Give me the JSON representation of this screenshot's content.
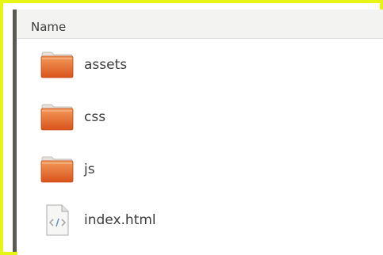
{
  "column_header": "Name",
  "items": [
    {
      "name": "assets",
      "type": "folder",
      "icon": "folder-icon"
    },
    {
      "name": "css",
      "type": "folder",
      "icon": "folder-icon"
    },
    {
      "name": "js",
      "type": "folder",
      "icon": "folder-icon"
    },
    {
      "name": "index.html",
      "type": "file",
      "icon": "html-file-icon"
    }
  ],
  "colors": {
    "border_highlight": "#e6f513",
    "folder_orange": "#e8662a",
    "header_bg": "#f3f3f2"
  }
}
